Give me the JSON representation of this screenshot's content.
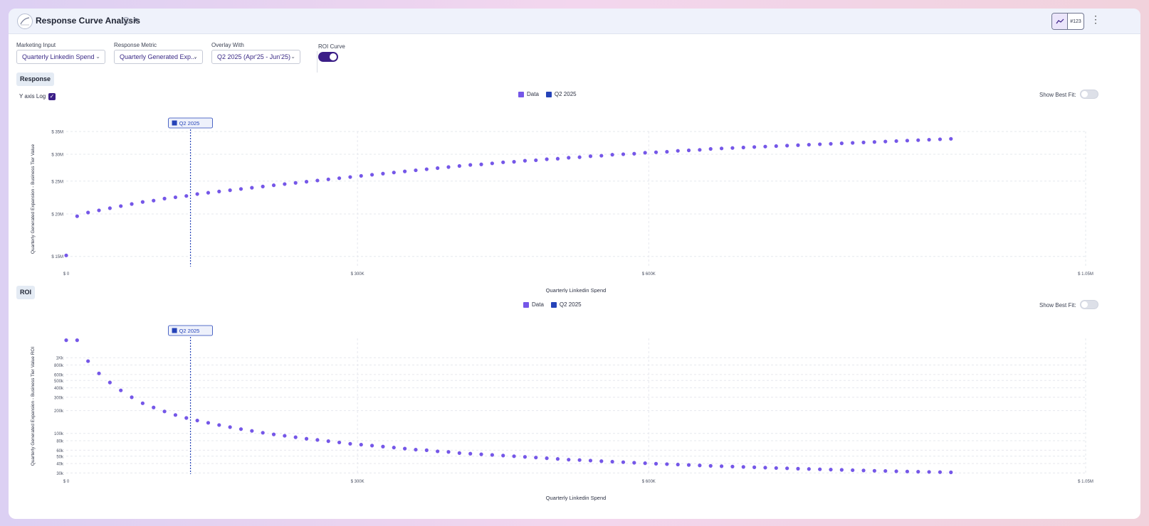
{
  "header": {
    "title": "Response Curve Analysis",
    "view_toggle_num_label": "#123"
  },
  "controls": {
    "marketing_input": {
      "label": "Marketing Input",
      "value": "Quarterly Linkedin Spend"
    },
    "response_metric": {
      "label": "Response Metric",
      "value": "Quarterly Generated Exp..."
    },
    "overlay_with": {
      "label": "Overlay With",
      "value": "Q2 2025 (Apr'25 - Jun'25)"
    },
    "roi_curve": {
      "label": "ROI Curve",
      "on": true
    }
  },
  "colors": {
    "data": "#7557e8",
    "overlay": "#2543b8",
    "accent": "#3b1e87"
  },
  "response_section": {
    "badge": "Response",
    "y_axis_log_label": "Y axis Log",
    "y_axis_log_checked": true,
    "legend_data": "Data",
    "legend_overlay": "Q2 2025",
    "best_fit_label": "Show Best Fit:",
    "marker_label": "Q2 2025"
  },
  "roi_section": {
    "badge": "ROI",
    "legend_data": "Data",
    "legend_overlay": "Q2 2025",
    "best_fit_label": "Show Best Fit:",
    "marker_label": "Q2 2025"
  },
  "chart_data": [
    {
      "type": "scatter",
      "name": "response",
      "xlabel": "Quarterly Linkedin Spend",
      "ylabel": "Quarterly Generated Expansion - Business Tier Value",
      "xlim": [
        0,
        1050000
      ],
      "ylim": [
        14000000,
        35000000
      ],
      "y_scale": "log",
      "x_ticks": [
        {
          "v": 0,
          "label": "$ 0"
        },
        {
          "v": 300000,
          "label": "$ 300K"
        },
        {
          "v": 600000,
          "label": "$ 600K"
        },
        {
          "v": 1050000,
          "label": "$ 1.05M"
        }
      ],
      "y_ticks": [
        {
          "v": 15000000,
          "label": "$ 15M"
        },
        {
          "v": 20000000,
          "label": "$ 20M"
        },
        {
          "v": 25000000,
          "label": "$ 25M"
        },
        {
          "v": 30000000,
          "label": "$ 30M"
        },
        {
          "v": 35000000,
          "label": "$ 35M"
        }
      ],
      "marker_x": 128000,
      "x_start": 0,
      "x_step": 11250,
      "y": [
        15100000,
        19700000,
        20200000,
        20500000,
        20800000,
        21100000,
        21400000,
        21700000,
        21900000,
        22200000,
        22400000,
        22600000,
        22900000,
        23100000,
        23300000,
        23500000,
        23700000,
        23900000,
        24100000,
        24300000,
        24500000,
        24700000,
        24900000,
        25100000,
        25300000,
        25500000,
        25700000,
        25900000,
        26100000,
        26300000,
        26500000,
        26700000,
        26900000,
        27100000,
        27300000,
        27500000,
        27700000,
        27900000,
        28000000,
        28200000,
        28400000,
        28500000,
        28700000,
        28800000,
        29000000,
        29100000,
        29300000,
        29400000,
        29600000,
        29700000,
        29900000,
        30000000,
        30100000,
        30300000,
        30400000,
        30500000,
        30700000,
        30800000,
        30900000,
        31100000,
        31200000,
        31300000,
        31400000,
        31500000,
        31600000,
        31700000,
        31800000,
        31900000,
        32000000,
        32100000,
        32200000,
        32300000,
        32400000,
        32500000,
        32600000,
        32700000,
        32800000,
        32900000,
        33000000,
        33100000,
        33200000,
        33300000
      ]
    },
    {
      "type": "scatter",
      "name": "roi",
      "xlabel": "Quarterly Linkedin Spend",
      "ylabel": "Quarterly Generated Expansion - Business Tier Value ROI",
      "xlim": [
        0,
        1050000
      ],
      "ylim": [
        29000,
        1800000
      ],
      "y_scale": "log",
      "x_ticks": [
        {
          "v": 0,
          "label": "$ 0"
        },
        {
          "v": 300000,
          "label": "$ 300K"
        },
        {
          "v": 600000,
          "label": "$ 600K"
        },
        {
          "v": 1050000,
          "label": "$ 1.05M"
        }
      ],
      "y_ticks": [
        {
          "v": 30000,
          "label": "30k"
        },
        {
          "v": 40000,
          "label": "40k"
        },
        {
          "v": 50000,
          "label": "50k"
        },
        {
          "v": 60000,
          "label": "60k"
        },
        {
          "v": 80000,
          "label": "80k"
        },
        {
          "v": 100000,
          "label": "100k"
        },
        {
          "v": 200000,
          "label": "200k"
        },
        {
          "v": 300000,
          "label": "300k"
        },
        {
          "v": 400000,
          "label": "400k"
        },
        {
          "v": 500000,
          "label": "500k"
        },
        {
          "v": 600000,
          "label": "600k"
        },
        {
          "v": 800000,
          "label": "800k"
        },
        {
          "v": 1000000,
          "label": "1Kk"
        }
      ],
      "marker_x": 128000,
      "x_start": 0,
      "x_step": 11250,
      "y": [
        1700000,
        1700000,
        900000,
        620000,
        470000,
        370000,
        300000,
        250000,
        220000,
        195000,
        175000,
        160000,
        148000,
        138000,
        129000,
        121000,
        114000,
        108000,
        102000,
        97000,
        93000,
        89000,
        85000,
        82000,
        79000,
        76000,
        73000,
        71000,
        69000,
        67000,
        65000,
        63000,
        61000,
        60000,
        58000,
        57000,
        55000,
        54000,
        53000,
        52000,
        51000,
        50000,
        49000,
        48000,
        47000,
        46000,
        45000,
        44500,
        43800,
        43000,
        42300,
        41700,
        41000,
        40400,
        39800,
        39300,
        38800,
        38300,
        37800,
        37300,
        36900,
        36500,
        36100,
        35700,
        35300,
        34900,
        34600,
        34200,
        33900,
        33600,
        33300,
        33000,
        32700,
        32400,
        32100,
        31900,
        31600,
        31400,
        31200,
        31000,
        30800,
        30600
      ]
    }
  ]
}
